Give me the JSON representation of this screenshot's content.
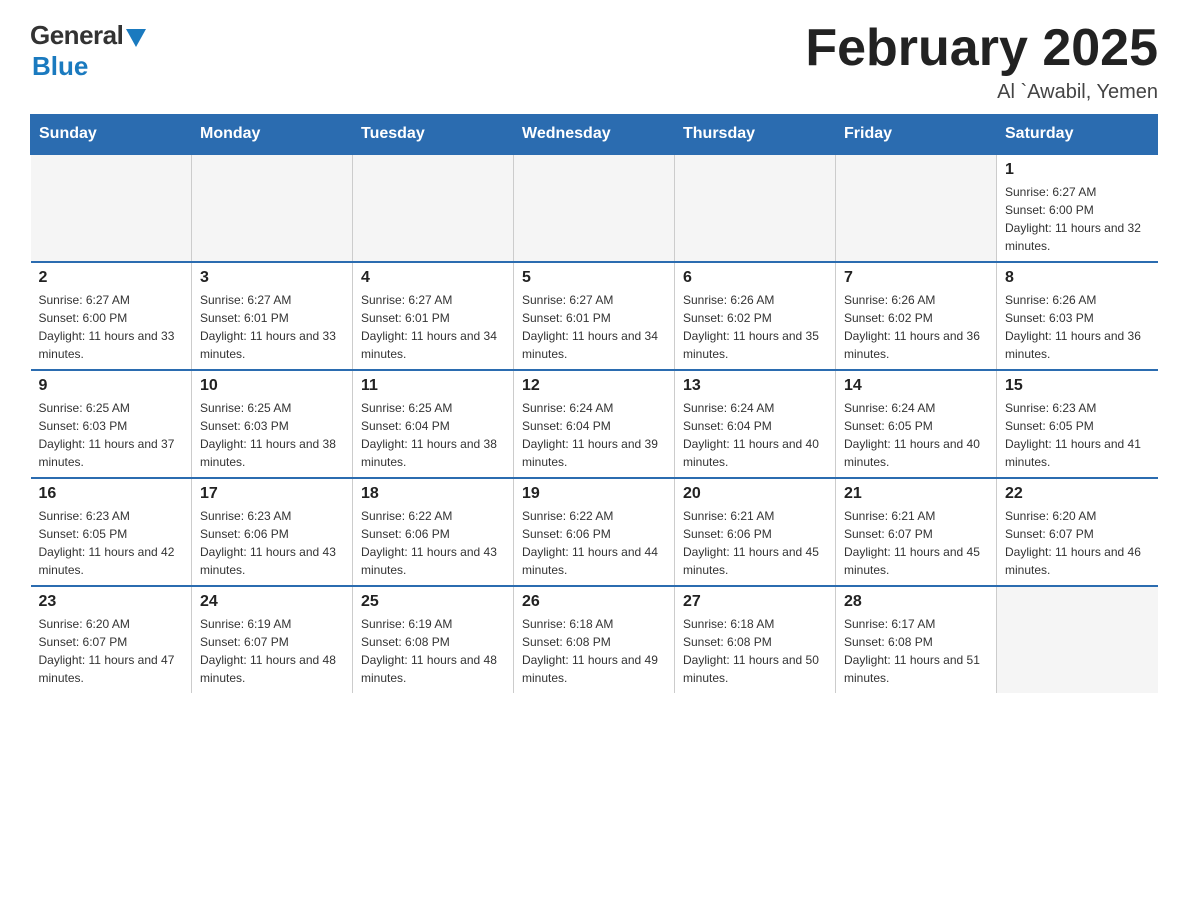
{
  "header": {
    "logo_general": "General",
    "logo_blue": "Blue",
    "month_title": "February 2025",
    "location": "Al `Awabil, Yemen"
  },
  "weekdays": [
    "Sunday",
    "Monday",
    "Tuesday",
    "Wednesday",
    "Thursday",
    "Friday",
    "Saturday"
  ],
  "weeks": [
    [
      {
        "day": "",
        "empty": true
      },
      {
        "day": "",
        "empty": true
      },
      {
        "day": "",
        "empty": true
      },
      {
        "day": "",
        "empty": true
      },
      {
        "day": "",
        "empty": true
      },
      {
        "day": "",
        "empty": true
      },
      {
        "day": "1",
        "sunrise": "6:27 AM",
        "sunset": "6:00 PM",
        "daylight": "11 hours and 32 minutes."
      }
    ],
    [
      {
        "day": "2",
        "sunrise": "6:27 AM",
        "sunset": "6:00 PM",
        "daylight": "11 hours and 33 minutes."
      },
      {
        "day": "3",
        "sunrise": "6:27 AM",
        "sunset": "6:01 PM",
        "daylight": "11 hours and 33 minutes."
      },
      {
        "day": "4",
        "sunrise": "6:27 AM",
        "sunset": "6:01 PM",
        "daylight": "11 hours and 34 minutes."
      },
      {
        "day": "5",
        "sunrise": "6:27 AM",
        "sunset": "6:01 PM",
        "daylight": "11 hours and 34 minutes."
      },
      {
        "day": "6",
        "sunrise": "6:26 AM",
        "sunset": "6:02 PM",
        "daylight": "11 hours and 35 minutes."
      },
      {
        "day": "7",
        "sunrise": "6:26 AM",
        "sunset": "6:02 PM",
        "daylight": "11 hours and 36 minutes."
      },
      {
        "day": "8",
        "sunrise": "6:26 AM",
        "sunset": "6:03 PM",
        "daylight": "11 hours and 36 minutes."
      }
    ],
    [
      {
        "day": "9",
        "sunrise": "6:25 AM",
        "sunset": "6:03 PM",
        "daylight": "11 hours and 37 minutes."
      },
      {
        "day": "10",
        "sunrise": "6:25 AM",
        "sunset": "6:03 PM",
        "daylight": "11 hours and 38 minutes."
      },
      {
        "day": "11",
        "sunrise": "6:25 AM",
        "sunset": "6:04 PM",
        "daylight": "11 hours and 38 minutes."
      },
      {
        "day": "12",
        "sunrise": "6:24 AM",
        "sunset": "6:04 PM",
        "daylight": "11 hours and 39 minutes."
      },
      {
        "day": "13",
        "sunrise": "6:24 AM",
        "sunset": "6:04 PM",
        "daylight": "11 hours and 40 minutes."
      },
      {
        "day": "14",
        "sunrise": "6:24 AM",
        "sunset": "6:05 PM",
        "daylight": "11 hours and 40 minutes."
      },
      {
        "day": "15",
        "sunrise": "6:23 AM",
        "sunset": "6:05 PM",
        "daylight": "11 hours and 41 minutes."
      }
    ],
    [
      {
        "day": "16",
        "sunrise": "6:23 AM",
        "sunset": "6:05 PM",
        "daylight": "11 hours and 42 minutes."
      },
      {
        "day": "17",
        "sunrise": "6:23 AM",
        "sunset": "6:06 PM",
        "daylight": "11 hours and 43 minutes."
      },
      {
        "day": "18",
        "sunrise": "6:22 AM",
        "sunset": "6:06 PM",
        "daylight": "11 hours and 43 minutes."
      },
      {
        "day": "19",
        "sunrise": "6:22 AM",
        "sunset": "6:06 PM",
        "daylight": "11 hours and 44 minutes."
      },
      {
        "day": "20",
        "sunrise": "6:21 AM",
        "sunset": "6:06 PM",
        "daylight": "11 hours and 45 minutes."
      },
      {
        "day": "21",
        "sunrise": "6:21 AM",
        "sunset": "6:07 PM",
        "daylight": "11 hours and 45 minutes."
      },
      {
        "day": "22",
        "sunrise": "6:20 AM",
        "sunset": "6:07 PM",
        "daylight": "11 hours and 46 minutes."
      }
    ],
    [
      {
        "day": "23",
        "sunrise": "6:20 AM",
        "sunset": "6:07 PM",
        "daylight": "11 hours and 47 minutes."
      },
      {
        "day": "24",
        "sunrise": "6:19 AM",
        "sunset": "6:07 PM",
        "daylight": "11 hours and 48 minutes."
      },
      {
        "day": "25",
        "sunrise": "6:19 AM",
        "sunset": "6:08 PM",
        "daylight": "11 hours and 48 minutes."
      },
      {
        "day": "26",
        "sunrise": "6:18 AM",
        "sunset": "6:08 PM",
        "daylight": "11 hours and 49 minutes."
      },
      {
        "day": "27",
        "sunrise": "6:18 AM",
        "sunset": "6:08 PM",
        "daylight": "11 hours and 50 minutes."
      },
      {
        "day": "28",
        "sunrise": "6:17 AM",
        "sunset": "6:08 PM",
        "daylight": "11 hours and 51 minutes."
      },
      {
        "day": "",
        "empty": true
      }
    ]
  ]
}
